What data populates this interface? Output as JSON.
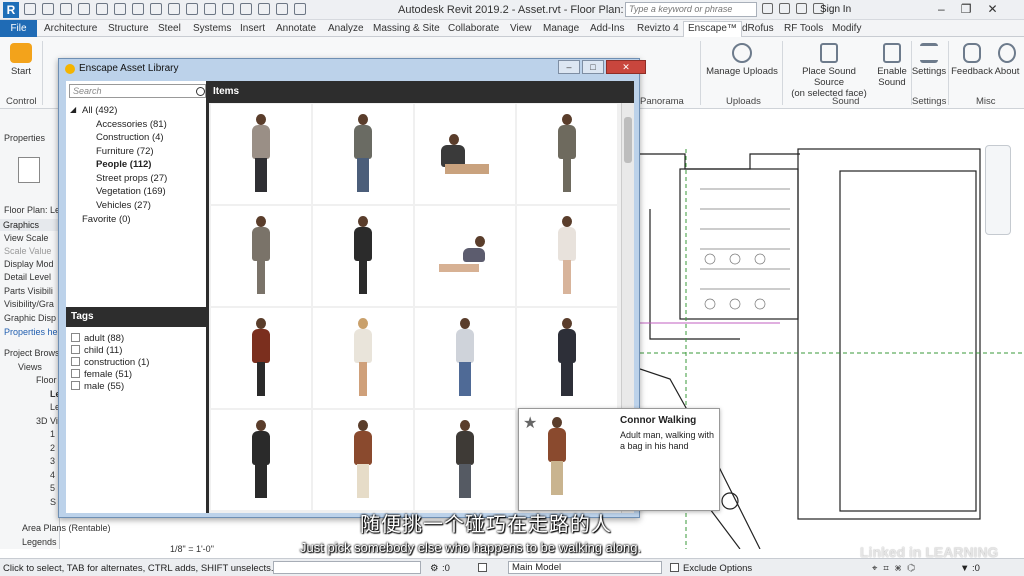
{
  "app": {
    "logo_letter": "R",
    "title": "Autodesk Revit 2019.2 - Asset.rvt - Floor Plan: Level 1",
    "search_placeholder": "Type a keyword or phrase",
    "sign_in": "Sign In"
  },
  "tabs": [
    "File",
    "Architecture",
    "Structure",
    "Steel",
    "Systems",
    "Insert",
    "Annotate",
    "Analyze",
    "Massing & Site",
    "Collaborate",
    "View",
    "Manage",
    "Add-Ins",
    "Revizto 4",
    "Enscape™",
    "dRofus",
    "RF Tools",
    "Modify"
  ],
  "ribbon": {
    "start": "Start",
    "control": "Control",
    "panorama": "Panorama",
    "manage_uploads": "Manage Uploads",
    "uploads": "Uploads",
    "place_sound": "Place Sound Source",
    "place_sound_sub": "(on selected face)",
    "enable_sound": "Enable",
    "enable_sound2": "Sound",
    "sound": "Sound",
    "settings": "Settings",
    "settings_group": "Settings",
    "feedback": "Feedback",
    "about": "About",
    "misc": "Misc"
  },
  "properties": {
    "title": "Properties",
    "type_selector": "Floor Plan: Le",
    "graphics": "Graphics",
    "rows": [
      "View Scale",
      "Scale Value",
      "Display Mod",
      "Detail Level",
      "Parts Visibili",
      "Visibility/Gra",
      "Graphic Disp"
    ],
    "help": "Properties he"
  },
  "project_browser": {
    "title": "Project Brows",
    "items": [
      "Views",
      "Floor",
      "Le",
      "Le",
      "3D Vi",
      "1",
      "2",
      "3",
      "4",
      "5",
      "S"
    ],
    "area_plans": "Area Plans (Rentable)",
    "legends": "Legends"
  },
  "dialog": {
    "title": "Enscape Asset Library",
    "search_placeholder": "Search",
    "categories": [
      {
        "label": "All (492)",
        "bold": false
      },
      {
        "label": "Accessories (81)",
        "bold": false
      },
      {
        "label": "Construction (4)",
        "bold": false
      },
      {
        "label": "Furniture (72)",
        "bold": false
      },
      {
        "label": "People (112)",
        "bold": true
      },
      {
        "label": "Street props (27)",
        "bold": false
      },
      {
        "label": "Vegetation (169)",
        "bold": false
      },
      {
        "label": "Vehicles (27)",
        "bold": false
      },
      {
        "label": "Favorite (0)",
        "bold": false
      }
    ],
    "tags_title": "Tags",
    "tags": [
      "adult (88)",
      "child (11)",
      "construction (1)",
      "female (51)",
      "male (55)"
    ],
    "items_title": "Items"
  },
  "tooltip": {
    "title": "Connor Walking",
    "description": "Adult man, walking with a bag in his hand"
  },
  "status": {
    "hint": "Click to select, TAB for alternates, CTRL adds, SHIFT unselects.",
    "scale": "1/8\" = 1'-0\"",
    "zero": ":0",
    "model": "Main Model",
    "exclude": "Exclude Options",
    "zero2": ":0"
  },
  "subtitles": {
    "chinese": "随便挑一个碰巧在走路的人",
    "english": "Just pick somebody else who happens to be walking along."
  },
  "watermark": "Linked in LEARNING"
}
